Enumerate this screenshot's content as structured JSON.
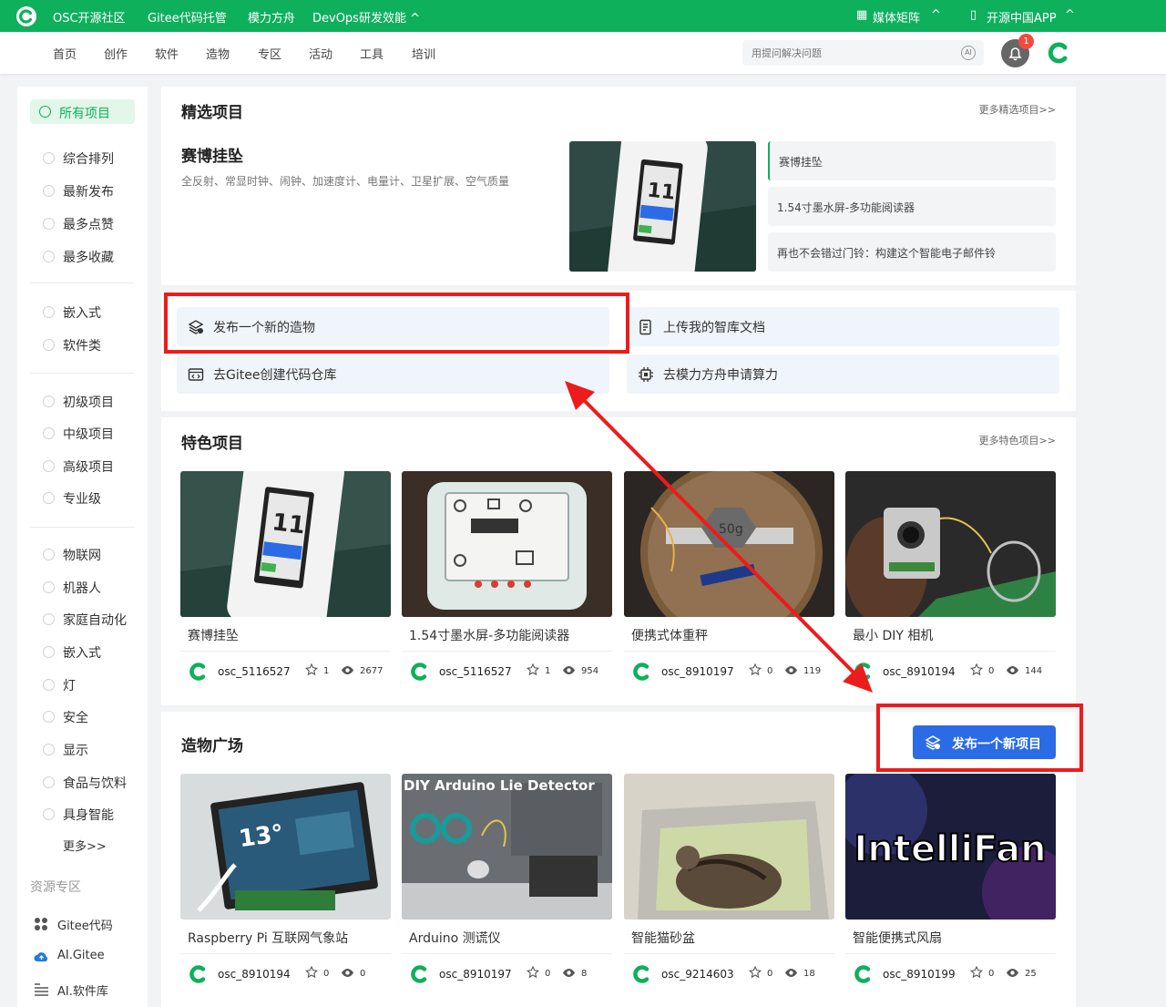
{
  "topbar": {
    "brand": "OSC开源社区",
    "links": [
      "Gitee代码托管",
      "模力方舟",
      "DevOps研发效能 ^"
    ],
    "media": "媒体矩阵",
    "app": "开源中国APP"
  },
  "nav": {
    "items": [
      "首页",
      "创作",
      "软件",
      "造物",
      "专区",
      "活动",
      "工具",
      "培训"
    ],
    "search_placeholder": "用提问解决问题",
    "ai_label": "AI",
    "notifications": "1"
  },
  "sidebar": {
    "active": "所有项目",
    "sort": [
      "综合排列",
      "最新发布",
      "最多点赞",
      "最多收藏"
    ],
    "types": [
      "嵌入式",
      "软件类"
    ],
    "levels": [
      "初级项目",
      "中级项目",
      "高级项目",
      "专业级"
    ],
    "tags": [
      "物联网",
      "机器人",
      "家庭自动化",
      "嵌入式",
      "灯",
      "安全",
      "显示",
      "食品与饮料",
      "具身智能"
    ],
    "more": "更多>>",
    "resources_title": "资源专区",
    "resources": [
      "Gitee代码",
      "AI.Gitee",
      "AI.软件库"
    ]
  },
  "featured": {
    "title": "精选项目",
    "more": "更多精选项目>>",
    "name": "赛博挂坠",
    "desc": "全反射、常显时钟、闹钟、加速度计、电量计、卫星扩展、空气质量",
    "list": [
      "赛博挂坠",
      "1.54寸墨水屏-多功能阅读器",
      "再也不会错过门铃：构建这个智能电子邮件铃"
    ]
  },
  "actions": [
    "发布一个新的造物",
    "上传我的智库文档",
    "去Gitee创建代码仓库",
    "去模力方舟申请算力"
  ],
  "special": {
    "title": "特色项目",
    "more": "更多特色项目>>",
    "projects": [
      {
        "name": "赛博挂坠",
        "author": "osc_5116527",
        "stars": "1",
        "views": "2677"
      },
      {
        "name": "1.54寸墨水屏-多功能阅读器",
        "author": "osc_5116527",
        "stars": "1",
        "views": "954"
      },
      {
        "name": "便携式体重秤",
        "author": "osc_8910197",
        "stars": "0",
        "views": "119"
      },
      {
        "name": "最小 DIY 相机",
        "author": "osc_8910194",
        "stars": "0",
        "views": "144"
      }
    ]
  },
  "plaza": {
    "title": "造物广场",
    "publish": "发布一个新项目",
    "projects": [
      {
        "name": "Raspberry Pi 互联网气象站",
        "author": "osc_8910194",
        "stars": "0",
        "views": "0"
      },
      {
        "name": "Arduino 测谎仪",
        "author": "osc_8910197",
        "stars": "0",
        "views": "8"
      },
      {
        "name": "智能猫砂盆",
        "author": "osc_9214603",
        "stars": "0",
        "views": "18"
      },
      {
        "name": "智能便携式风扇",
        "author": "osc_8910199",
        "stars": "0",
        "views": "25"
      }
    ]
  },
  "image_text": {
    "arduino_title": "DIY Arduino Lie Detector",
    "fan_title": "IntelliFan"
  },
  "colors": {
    "brand": "#0fb05c",
    "button": "#2b6be6",
    "highlight": "#ec1c1c"
  }
}
